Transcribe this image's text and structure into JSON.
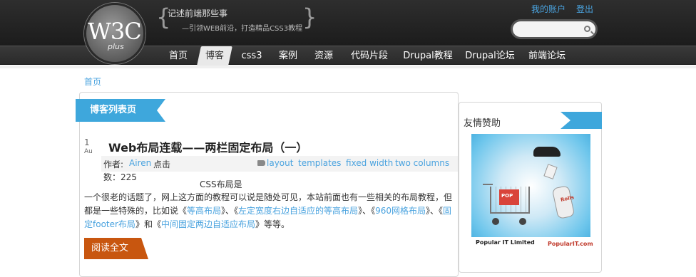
{
  "logo": {
    "text": "W3C",
    "sub": "plus"
  },
  "tagline": {
    "line1": "记述前端那些事",
    "line2": "—引领WEB前沿，打造精品CSS3教程",
    "brace_left": "{",
    "brace_right": "}"
  },
  "account": {
    "my_account": "我的账户",
    "logout": "登出"
  },
  "search": {
    "placeholder": ""
  },
  "nav": [
    "首页",
    "博客",
    "css3",
    "案例",
    "资源",
    "代码片段",
    "Drupal教程",
    "Drupal论坛",
    "前端论坛"
  ],
  "nav_active": "博客",
  "breadcrumb": "首页",
  "main": {
    "ribbon": "博客列表页",
    "date_day": "1",
    "date_month": "Au",
    "post": {
      "title": "Web布局连载——两栏固定布局（一）",
      "author_label": "作者:",
      "author": "Airen",
      "click_label": "点击",
      "views": "数：225",
      "tags": [
        "layout",
        "templates",
        "fixed width",
        "two columns"
      ],
      "excerpt_head": "CSS布局是",
      "excerpt_text_1": "一个很老的话题了，网上这方面的教程可以说是随处可见，本站前面也有一些相关的布局教程，但都是一些特殊的，比如说《",
      "link1": "等高布局",
      "sep1": "》、《",
      "link2": "左定宽度右边自适应的等高布局",
      "sep2": "》、《",
      "link3": "960网格布局",
      "sep3": "》、《",
      "link4": "固定footer布局",
      "sep4": "》和《",
      "link5": "中间固定两边自适应布局",
      "excerpt_end": "》等等。"
    },
    "read_more": "阅读全文"
  },
  "sidebar": {
    "title": "友情赞助",
    "ad": {
      "company": "Popular IT Limited",
      "url": "PopularIT.com",
      "box": "POP",
      "phone": "Rolls"
    }
  },
  "colors": {
    "accent": "#3ea7dc",
    "link": "#4aa3df",
    "orange": "#c8560f",
    "header": "#2a2a2a"
  }
}
